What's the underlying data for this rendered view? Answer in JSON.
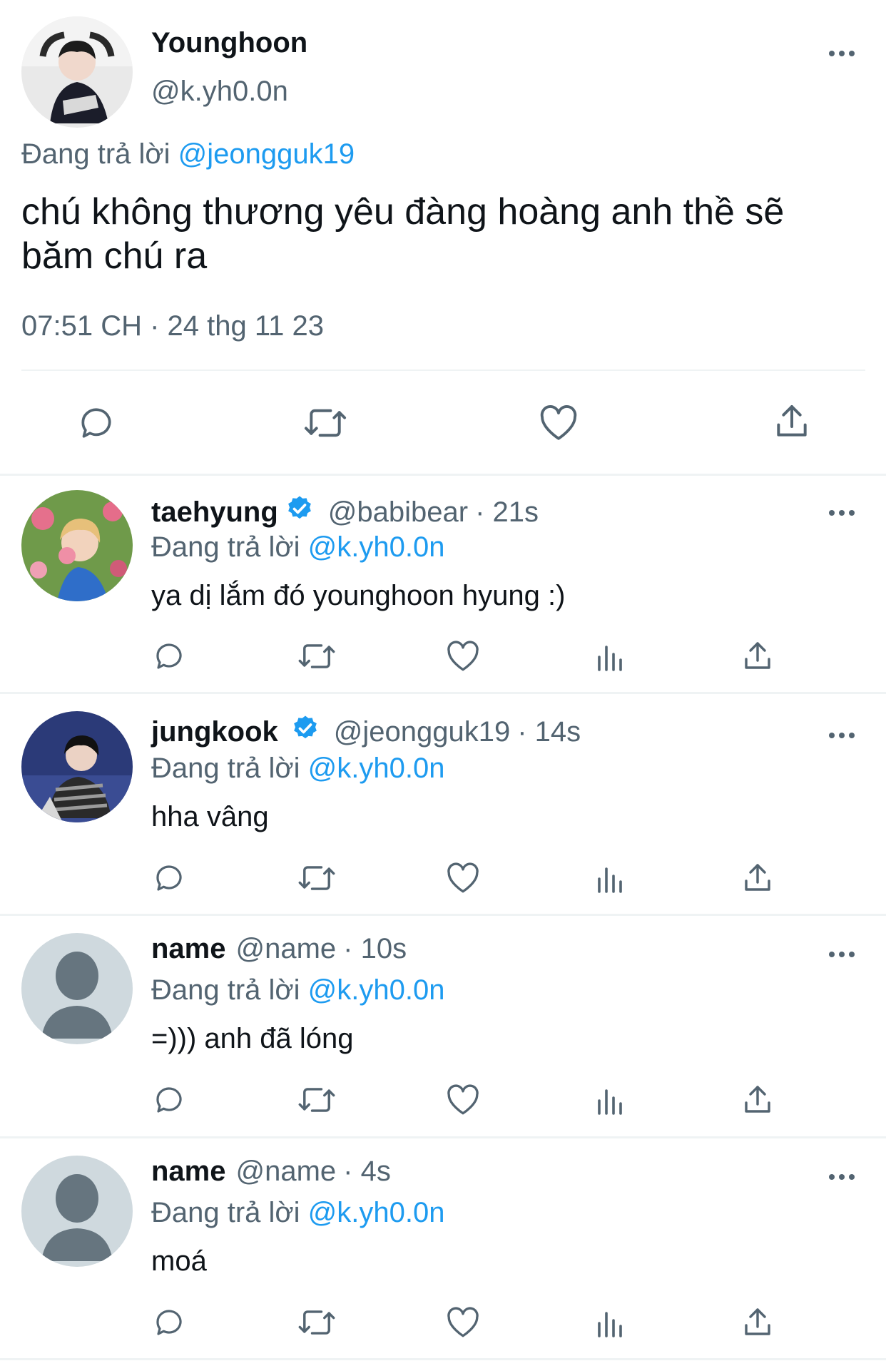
{
  "main": {
    "name": "Younghoon",
    "handle": "@k.yh0.0n",
    "replying_label": "Đang trả lời",
    "replying_to": "@jeongguk19",
    "text": "chú không thương yêu đàng hoàng anh thề sẽ băm chú ra",
    "timestamp": "07:51 CH · 24 thg 11 23"
  },
  "replies": [
    {
      "name": "taehyung",
      "verified": true,
      "handle": "@babibear",
      "time": "· 21s",
      "replying_label": "Đang trả lời",
      "replying_to": "@k.yh0.0n",
      "text": "ya dị lắm đó younghoon hyung :)"
    },
    {
      "name": "jungkook",
      "verified": true,
      "handle": "@jeongguk19",
      "time": "· 14s",
      "replying_label": "Đang trả lời",
      "replying_to": "@k.yh0.0n",
      "text": "hha vâng"
    },
    {
      "name": "name",
      "verified": false,
      "handle": "@name",
      "time": "· 10s",
      "replying_label": "Đang trả lời",
      "replying_to": "@k.yh0.0n",
      "text": "=))) anh đã lóng"
    },
    {
      "name": "name",
      "verified": false,
      "handle": "@name",
      "time": "· 4s",
      "replying_label": "Đang trả lời",
      "replying_to": "@k.yh0.0n",
      "text": "moá"
    }
  ],
  "icons": {
    "reply": "reply-icon",
    "retweet": "retweet-icon",
    "like": "heart-icon",
    "views": "views-icon",
    "share": "share-icon",
    "more": "more-icon",
    "verified": "verified-badge-icon"
  },
  "colors": {
    "text": "#0f1419",
    "secondary": "#536471",
    "accent": "#1d9bf0",
    "divider": "#eff3f4"
  }
}
